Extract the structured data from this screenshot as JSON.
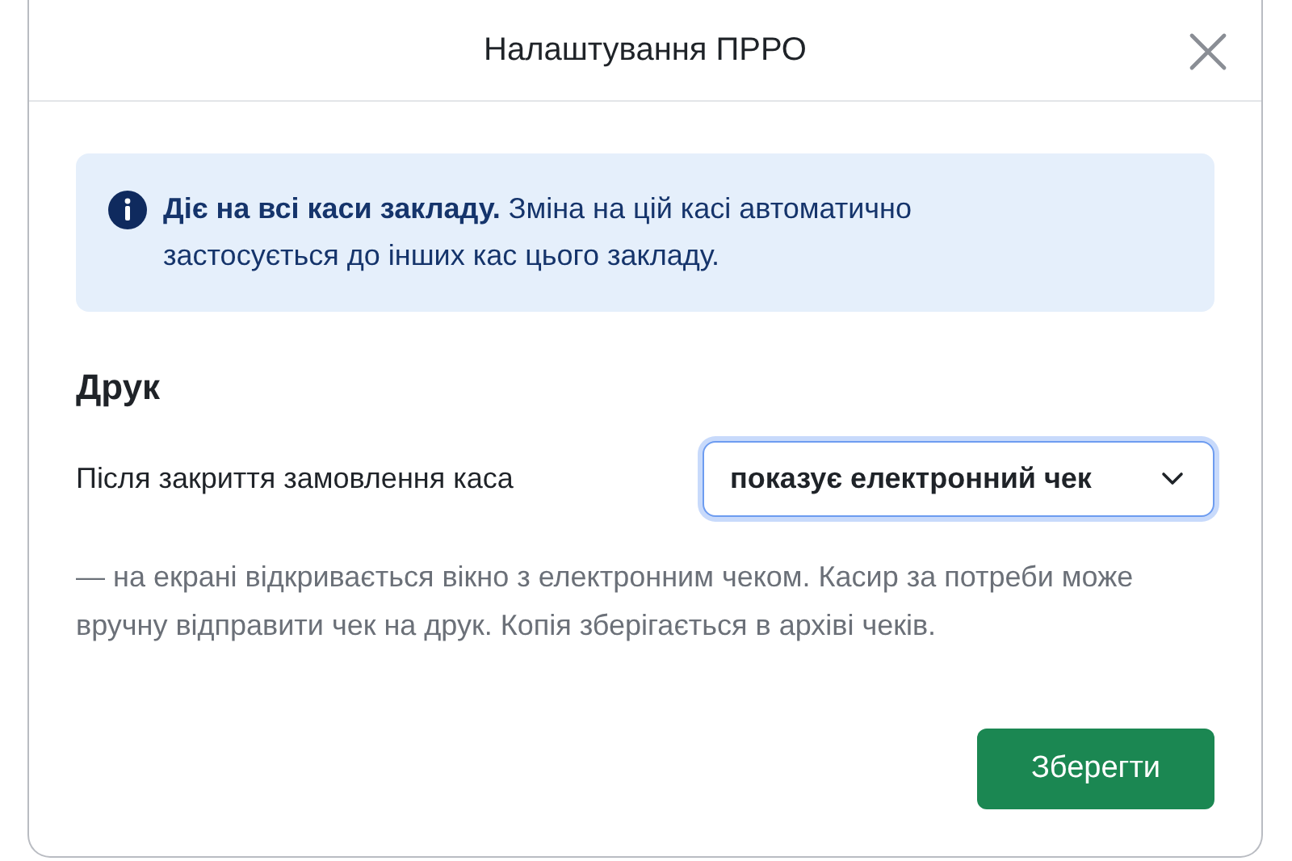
{
  "dialog": {
    "title": "Налаштування ПРРО"
  },
  "info": {
    "text": "**Діє на всі каси закладу.** Зміна на цій касі автоматично застосується до інших кас цього закладу."
  },
  "section": {
    "heading": "Друк"
  },
  "setting": {
    "label": "Після закриття замовлення каса",
    "value": "показує електронний чек",
    "focused": true
  },
  "description": "— на екрані відкривається вікно з електронним чеком. Касир за потреби може вручну відправити чек на друк. Копія зберігається в архіві чеків.",
  "save_button": "Зберегти"
}
